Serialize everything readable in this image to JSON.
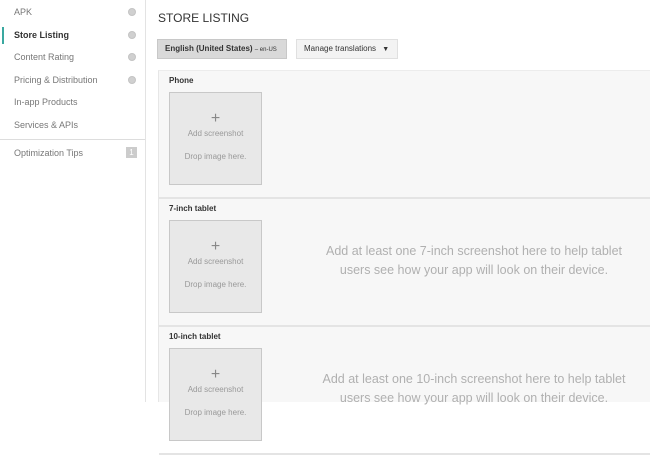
{
  "sidebar": {
    "items": [
      {
        "label": "APK",
        "check": true
      },
      {
        "label": "Store Listing",
        "check": true,
        "active": true
      },
      {
        "label": "Content Rating",
        "check": true
      },
      {
        "label": "Pricing & Distribution",
        "check": true
      },
      {
        "label": "In-app Products"
      },
      {
        "label": "Services & APIs"
      }
    ],
    "tips": {
      "label": "Optimization Tips",
      "count": "1"
    }
  },
  "header": {
    "title": "STORE LISTING",
    "language": "English (United States)",
    "language_code": "– en-US",
    "manage": "Manage translations",
    "manage_caret": "▼"
  },
  "sections": [
    {
      "label": "Phone",
      "plus": "+",
      "add": "Add screenshot",
      "drop": "Drop image here.",
      "message": ""
    },
    {
      "label": "7-inch tablet",
      "plus": "+",
      "add": "Add screenshot",
      "drop": "Drop image here.",
      "message": "Add at least one 7-inch screenshot here to help tablet users see how your app will look on their device."
    },
    {
      "label": "10-inch tablet",
      "plus": "+",
      "add": "Add screenshot",
      "drop": "Drop image here.",
      "message": "Add at least one 10-inch screenshot here to help tablet users see how your app will look on their device."
    }
  ]
}
